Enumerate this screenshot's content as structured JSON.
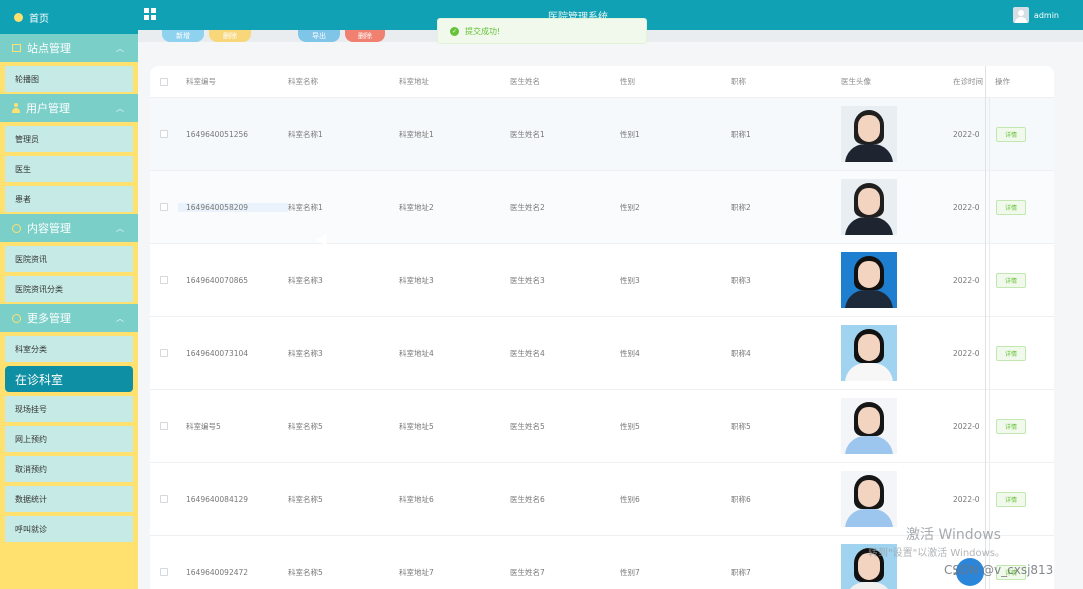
{
  "sidebar": {
    "home": "首页",
    "groups": [
      {
        "label": "站点管理",
        "items": [
          "轮播图"
        ]
      },
      {
        "label": "用户管理",
        "items": [
          "管理员",
          "医生",
          "患者"
        ]
      },
      {
        "label": "内容管理",
        "items": [
          "医院资讯",
          "医院资讯分类"
        ]
      },
      {
        "label": "更多管理",
        "items": [
          "科室分类",
          "在诊科室",
          "现场挂号",
          "网上预约",
          "取消预约",
          "数据统计",
          "呼叫就诊"
        ]
      }
    ]
  },
  "topbar": {
    "title": "医院管理系统",
    "user": "admin"
  },
  "toast": {
    "message": "提交成功!"
  },
  "toolbar": {
    "buttons": [
      "新增",
      "删除",
      "导出",
      "删除"
    ]
  },
  "table": {
    "headers": [
      "科室编号",
      "科室名称",
      "科室地址",
      "医生姓名",
      "性别",
      "职称",
      "医生头像",
      "在诊时间",
      "操作"
    ],
    "rows": [
      {
        "id": "1649640051256",
        "name": "科室名称1",
        "addr": "科室地址1",
        "doctor": "医生姓名1",
        "sex": "性别1",
        "title": "职称1",
        "date": "2022-0",
        "op": "详情"
      },
      {
        "id": "1649640058209",
        "name": "科室名称1",
        "addr": "科室地址2",
        "doctor": "医生姓名2",
        "sex": "性别2",
        "title": "职称2",
        "date": "2022-0",
        "op": "详情"
      },
      {
        "id": "1649640070865",
        "name": "科室名称3",
        "addr": "科室地址3",
        "doctor": "医生姓名3",
        "sex": "性别3",
        "title": "职称3",
        "date": "2022-0",
        "op": "详情"
      },
      {
        "id": "1649640073104",
        "name": "科室名称3",
        "addr": "科室地址4",
        "doctor": "医生姓名4",
        "sex": "性别4",
        "title": "职称4",
        "date": "2022-0",
        "op": "详情"
      },
      {
        "id": "科室编号5",
        "name": "科室名称5",
        "addr": "科室地址5",
        "doctor": "医生姓名5",
        "sex": "性别5",
        "title": "职称5",
        "date": "2022-0",
        "op": "详情"
      },
      {
        "id": "1649640084129",
        "name": "科室名称5",
        "addr": "科室地址6",
        "doctor": "医生姓名6",
        "sex": "性别6",
        "title": "职称6",
        "date": "2022-0",
        "op": "详情"
      },
      {
        "id": "1649640092472",
        "name": "科室名称5",
        "addr": "科室地址7",
        "doctor": "医生姓名7",
        "sex": "性别7",
        "title": "职称7",
        "date": "2022-0",
        "op": "详情"
      }
    ]
  },
  "watermark": {
    "line1": "激活 Windows",
    "line2": "转到\"设置\"以激活 Windows。",
    "csdn": "CSDN @v_cxsj813"
  },
  "colors": {
    "primary": "#10a2b4",
    "sidebar_accent": "#ffe170",
    "success": "#67c23a"
  }
}
